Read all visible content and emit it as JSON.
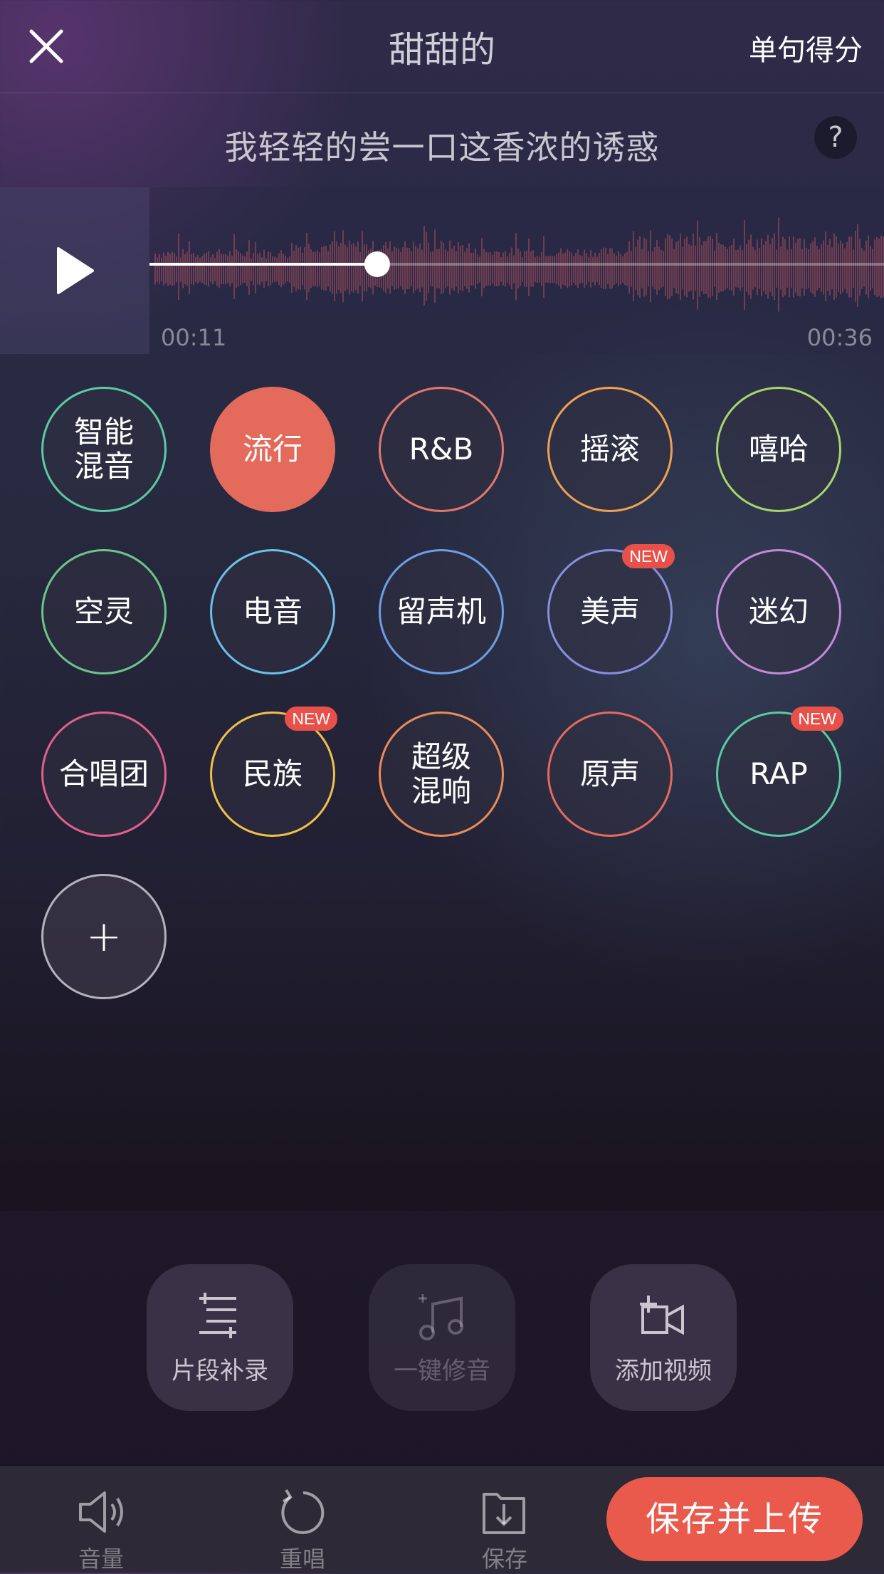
{
  "header": {
    "title": "甜甜的",
    "score_label": "单句得分"
  },
  "lyric": {
    "text": "我轻轻的尝一口这香浓的诱惑",
    "help": "?"
  },
  "player": {
    "time_start": "00:11",
    "time_end": "00:36",
    "progress": 0.31
  },
  "effects": [
    {
      "label": "智能\n混音",
      "color": "#5bc9a6",
      "active": false,
      "badge": ""
    },
    {
      "label": "流行",
      "color": "#e46a5c",
      "active": true,
      "badge": ""
    },
    {
      "label": "R&B",
      "color": "#e4776d",
      "active": false,
      "badge": ""
    },
    {
      "label": "摇滚",
      "color": "#f0a150",
      "active": false,
      "badge": ""
    },
    {
      "label": "嘻哈",
      "color": "#a8d46a",
      "active": false,
      "badge": ""
    },
    {
      "label": "空灵",
      "color": "#6cc58a",
      "active": false,
      "badge": ""
    },
    {
      "label": "电音",
      "color": "#6cc0e6",
      "active": false,
      "badge": ""
    },
    {
      "label": "留声机",
      "color": "#6c9fe6",
      "active": false,
      "badge": ""
    },
    {
      "label": "美声",
      "color": "#8a8ee0",
      "active": false,
      "badge": "NEW"
    },
    {
      "label": "迷幻",
      "color": "#c38ad8",
      "active": false,
      "badge": ""
    },
    {
      "label": "合唱团",
      "color": "#e0608e",
      "active": false,
      "badge": ""
    },
    {
      "label": "民族",
      "color": "#f0c048",
      "active": false,
      "badge": "NEW"
    },
    {
      "label": "超级\n混响",
      "color": "#ec8a58",
      "active": false,
      "badge": ""
    },
    {
      "label": "原声",
      "color": "#e66a60",
      "active": false,
      "badge": ""
    },
    {
      "label": "RAP",
      "color": "#5bc9a6",
      "active": false,
      "badge": "NEW"
    }
  ],
  "add_effect": "+",
  "tools": {
    "segment": "片段补录",
    "autotune": "一键修音",
    "video": "添加视频"
  },
  "bottom": {
    "volume": "音量",
    "resing": "重唱",
    "save": "保存",
    "upload": "保存并上传"
  }
}
